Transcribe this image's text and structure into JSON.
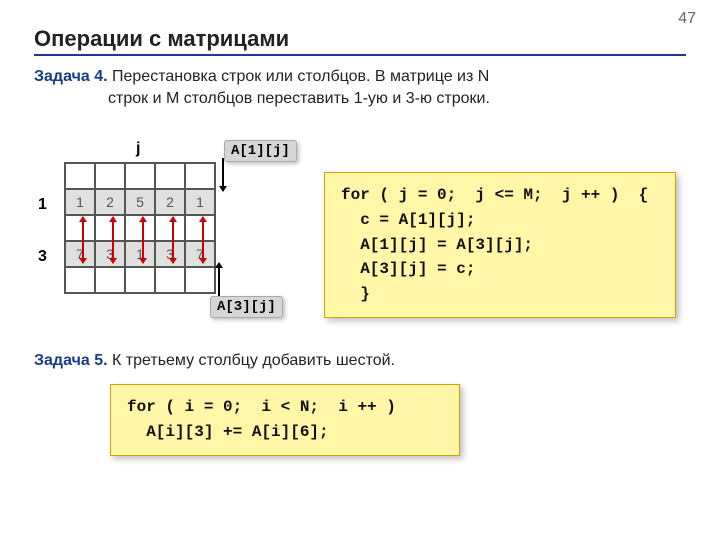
{
  "page_number": "47",
  "title": "Операции с матрицами",
  "problem4": {
    "label": "Задача 4.",
    "text_line1": " Перестановка строк или столбцов. В матрице из N",
    "text_line2": "строк и M столбцов переставить 1-ую и 3-ю строки."
  },
  "matrix": {
    "j_label": "j",
    "row1_label": "1",
    "row3_label": "3",
    "rows": [
      [
        "",
        "",
        "",
        "",
        ""
      ],
      [
        "1",
        "2",
        "5",
        "2",
        "1"
      ],
      [
        "",
        "",
        "",
        "",
        ""
      ],
      [
        "7",
        "3",
        "1",
        "3",
        "7"
      ],
      [
        "",
        "",
        "",
        "",
        ""
      ]
    ],
    "a1_label": "A[1][j]",
    "a3_label": "A[3][j]"
  },
  "code1": {
    "line1": "for ( j = 0;  j <= M;  j ++ )  {",
    "line2": "  c = A[1][j];",
    "line3": "  A[1][j] = A[3][j];",
    "line4": "  A[3][j] = c;",
    "line5": "  }"
  },
  "problem5": {
    "label": "Задача 5.",
    "text": " К третьему столбцу добавить шестой."
  },
  "code2": {
    "line1": "for ( i = 0;  i < N;  i ++ )",
    "line2": "  A[i][3] += A[i][6];"
  }
}
